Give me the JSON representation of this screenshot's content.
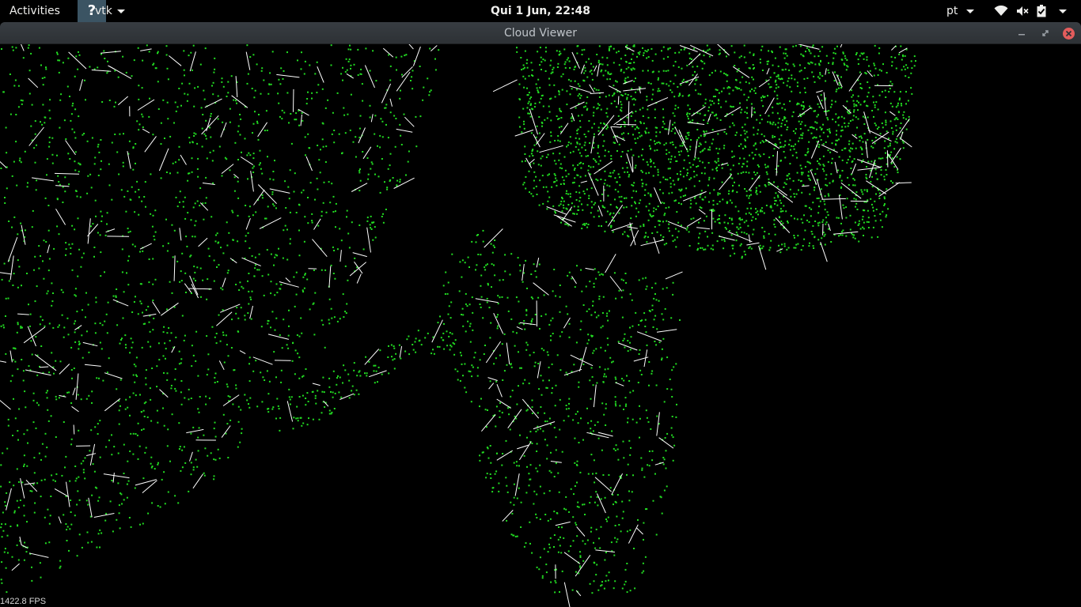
{
  "topbar": {
    "activities": "Activities",
    "app_icon_glyph": "?",
    "app_name": "vtk",
    "clock": "Qui  1 Jun, 22:48",
    "language": "pt",
    "icons": [
      "wifi-icon",
      "volume-muted-icon",
      "battery-icon",
      "system-menu-caret-icon"
    ]
  },
  "window": {
    "title": "Cloud Viewer",
    "controls": [
      "minimize",
      "maximize",
      "close"
    ]
  },
  "viewer": {
    "fps": "1422.8 FPS",
    "point_color": "#22dd22",
    "normal_color": "#ffffff",
    "background": "#000000"
  }
}
